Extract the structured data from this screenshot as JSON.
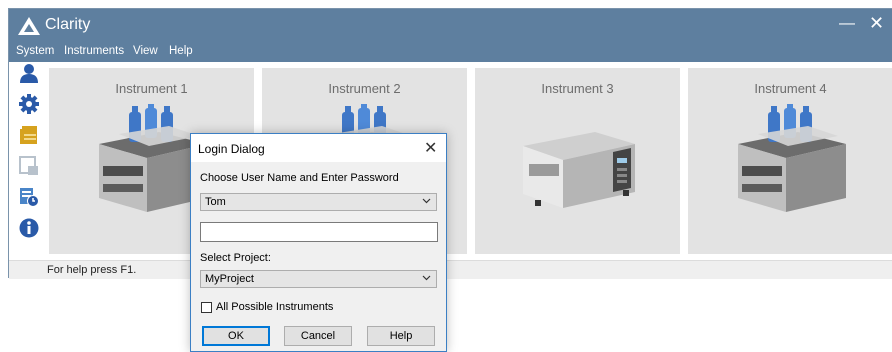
{
  "app": {
    "title": "Clarity",
    "menu": [
      "System",
      "Instruments",
      "View",
      "Help"
    ],
    "status_text": "For help press F1."
  },
  "sidebar_icons": [
    "user-icon",
    "gear-icon",
    "folder-icon",
    "report-icon",
    "schedule-icon",
    "info-icon"
  ],
  "instruments": [
    {
      "label": "Instrument 1",
      "icon": "lc-module-stack-icon"
    },
    {
      "label": "Instrument 2",
      "icon": "lc-module-stack-icon"
    },
    {
      "label": "Instrument 3",
      "icon": "gc-oven-icon"
    },
    {
      "label": "Instrument 4",
      "icon": "lc-module-stack-icon"
    }
  ],
  "login_dialog": {
    "title": "Login Dialog",
    "instruction": "Choose User Name and Enter Password",
    "user_name": "Tom",
    "password": "",
    "project_label": "Select Project:",
    "project": "MyProject",
    "all_instruments_label": "All Possible Instruments",
    "all_instruments_checked": false,
    "ok_label": "OK",
    "cancel_label": "Cancel",
    "help_label": "Help"
  },
  "colors": {
    "titlebar": "#5e7f9f",
    "panel": "#e3e3e3",
    "accent_blue": "#2a5aa8",
    "dialog_border": "#3b7fc4"
  }
}
